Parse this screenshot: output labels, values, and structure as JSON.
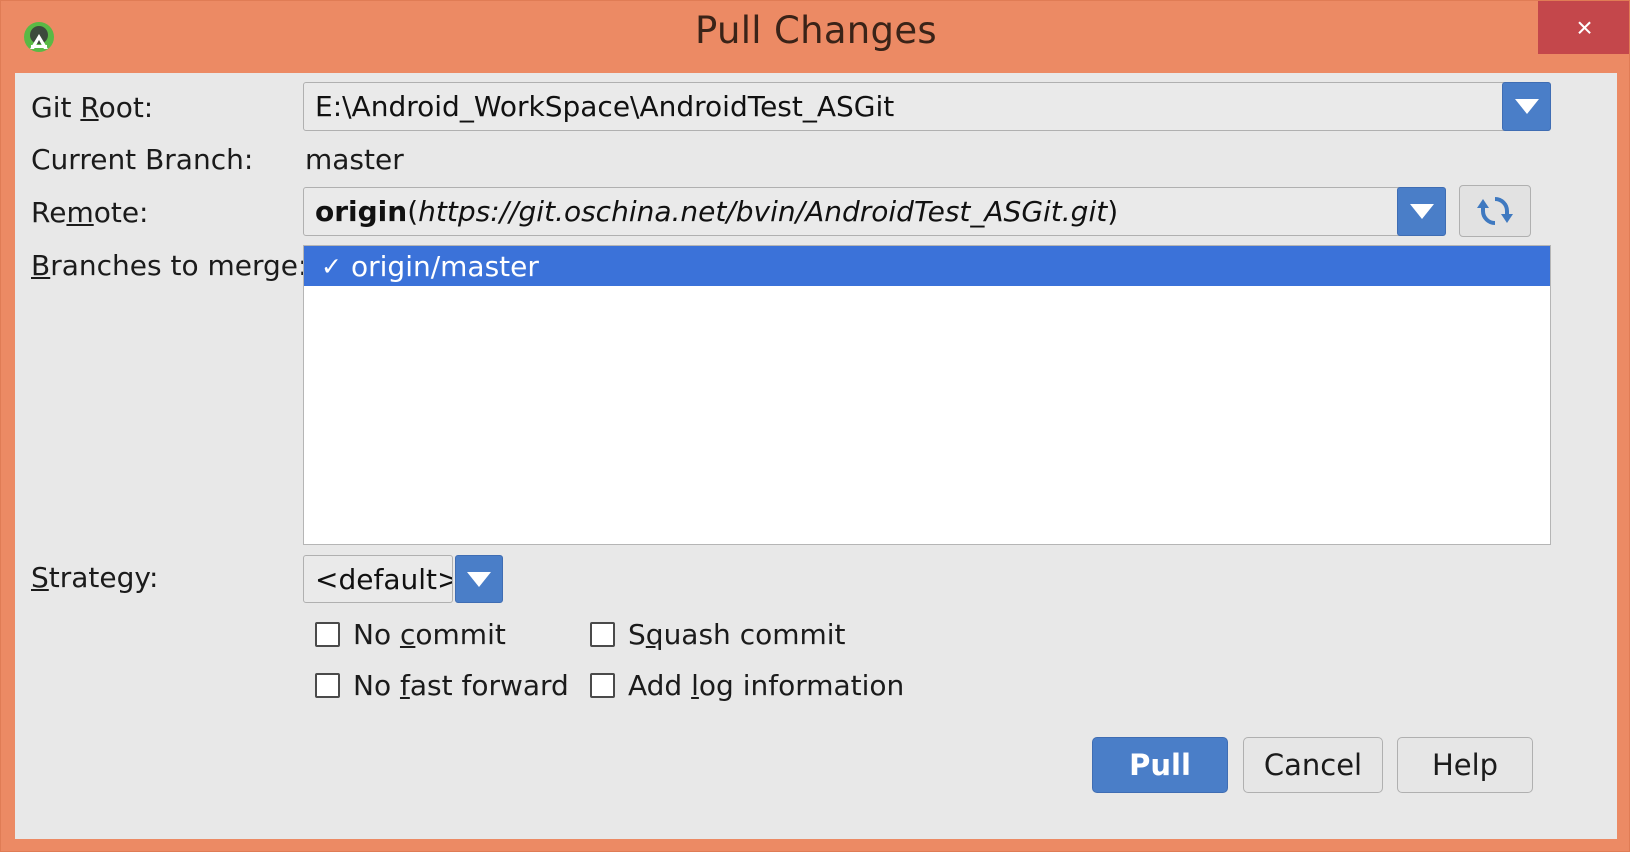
{
  "window": {
    "title": "Pull Changes",
    "close_label": "×",
    "app_icon": "android-studio-icon",
    "accent_blue": "#4a7ec8",
    "title_bar_color": "#ec8a64",
    "close_button_color": "#c4474b",
    "panel_color": "#e8e8e8",
    "selection_color": "#3b72d9"
  },
  "form": {
    "git_root": {
      "label_before": "Git ",
      "label_mnemonic": "R",
      "label_after": "oot:",
      "value": "E:\\Android_WorkSpace\\AndroidTest_ASGit"
    },
    "current_branch": {
      "label": "Current Branch:",
      "value": "master"
    },
    "remote": {
      "label_before": "Re",
      "label_mnemonic": "m",
      "label_after": "ote:",
      "name": "origin",
      "open_paren": "(",
      "url": "https://git.oschina.net/bvin/AndroidTest_ASGit.git",
      "close_paren": ")",
      "refresh_icon": "refresh-icon"
    },
    "branches_to_merge": {
      "label_before": "",
      "label_mnemonic": "B",
      "label_after": "ranches to merge:",
      "items": [
        {
          "checked": true,
          "check_glyph": "✓",
          "name": "origin/master"
        }
      ]
    },
    "strategy": {
      "label_before": "",
      "label_mnemonic": "S",
      "label_after": "trategy:",
      "value": "<default>"
    },
    "options": [
      {
        "before": "No ",
        "mnemonic": "c",
        "after": "ommit",
        "checked": false
      },
      {
        "before": "S",
        "mnemonic": "q",
        "after": "uash commit",
        "checked": false
      },
      {
        "before": "No ",
        "mnemonic": "f",
        "after": "ast forward",
        "checked": false
      },
      {
        "before": "Add ",
        "mnemonic": "l",
        "after": "og information",
        "checked": false
      }
    ]
  },
  "buttons": {
    "pull": "Pull",
    "cancel": "Cancel",
    "help": "Help"
  }
}
